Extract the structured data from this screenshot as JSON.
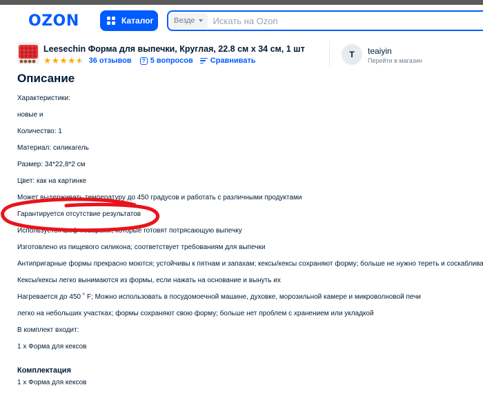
{
  "header": {
    "logo": "OZON",
    "catalog_label": "Каталог",
    "search_scope": "Везде",
    "search_placeholder": "Искать на Ozon"
  },
  "product": {
    "title": "Leesechin Форма для выпечки, Круглая, 22.8 см x 34 см, 1 шт",
    "rating": 4.5,
    "reviews": "36 отзывов",
    "questions": "5 вопросов",
    "compare": "Сравнивать",
    "seller_initial": "T",
    "seller_name": "teaiyin",
    "seller_link": "Перейти в магазин"
  },
  "description": {
    "title": "Описание",
    "lines": [
      "Характеристики:",
      "новые и",
      "Количество: 1",
      "Материал: силикагель",
      "Размер: 34*22,8*2 см",
      "Цвет: как на картинке",
      "Может выдерживать температуру до 450 градусов и работать с различными продуктами",
      "Гарантируется отсутствие результатов",
      "Используется шеф-поварами, которые готовят потрясающую выпечку",
      "Изготовлено из пищевого силикона; соответствует требованиям для выпечки",
      "Антипригарные формы прекрасно моются; устойчивы к пятнам и запахам; кексы/кексы сохраняют форму; больше не нужно тереть и соскабливать",
      "Кексы/кексы легко вынимаются из формы, если нажать на основание и вынуть их",
      "Нагревается до 450 ˚ F; Можно использовать в посудомоечной машине, духовке, морозильной камере и микроволновой печи",
      "легко на небольших участках; формы сохраняют свою форму; больше нет проблем с хранением или укладкой",
      "В комплект входит:",
      "1 x Форма для кексов"
    ]
  },
  "kit": {
    "title": "Комплектация",
    "text": "1 x Форма для кексов"
  },
  "colors": {
    "brand": "#005bff",
    "star": "#ffa800",
    "annotation": "#e8141c"
  }
}
